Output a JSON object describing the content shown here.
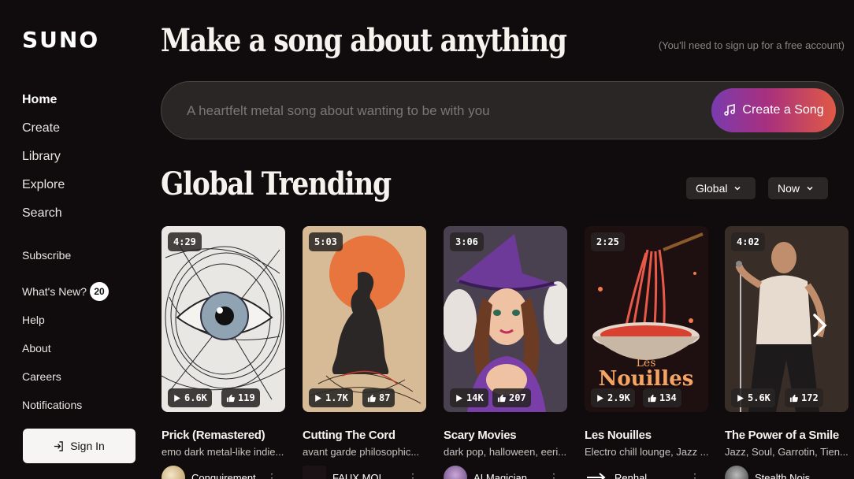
{
  "logo": "SUNO",
  "nav_main": [
    {
      "label": "Home",
      "active": true
    },
    {
      "label": "Create"
    },
    {
      "label": "Library"
    },
    {
      "label": "Explore"
    },
    {
      "label": "Search"
    }
  ],
  "nav_secondary": {
    "subscribe": "Subscribe",
    "whats_new": "What's New?",
    "whats_new_badge": "20",
    "help": "Help",
    "about": "About",
    "careers": "Careers",
    "notifications": "Notifications"
  },
  "sign_in": "Sign In",
  "headline": "Make a song about anything",
  "signup_note": "(You'll need to sign up for a free account)",
  "prompt": {
    "placeholder": "A heartfelt metal song about wanting to be with you",
    "button": "Create a Song"
  },
  "trending": {
    "title": "Global Trending",
    "filter_region": "Global",
    "filter_time": "Now"
  },
  "songs": [
    {
      "title": "Prick (Remastered)",
      "tags": "emo dark metal-like indie...",
      "duration": "4:29",
      "plays": "6.6K",
      "likes": "119",
      "author": "Conquirement"
    },
    {
      "title": "Cutting The Cord",
      "tags": "avant garde philosophic...",
      "duration": "5:03",
      "plays": "1.7K",
      "likes": "87",
      "author": "FAUX MOI"
    },
    {
      "title": "Scary Movies",
      "tags": "dark pop, halloween, eeri...",
      "duration": "3:06",
      "plays": "14K",
      "likes": "207",
      "author": "AI Magician"
    },
    {
      "title": "Les Nouilles",
      "tags": "Electro chill lounge, Jazz ...",
      "duration": "2:25",
      "plays": "2.9K",
      "likes": "134",
      "author": "Renhal",
      "cover_text": "Les",
      "cover_text2": "Nouilles"
    },
    {
      "title": "The Power of a Smile",
      "tags": "Jazz, Soul, Garrotin, Tien...",
      "duration": "4:02",
      "plays": "5.6K",
      "likes": "172",
      "author": "Stealth Nois"
    }
  ],
  "colors": {
    "background": "#100c0d",
    "create_gradient": [
      "#7a3bb0",
      "#a8307e",
      "#e05a45"
    ]
  }
}
